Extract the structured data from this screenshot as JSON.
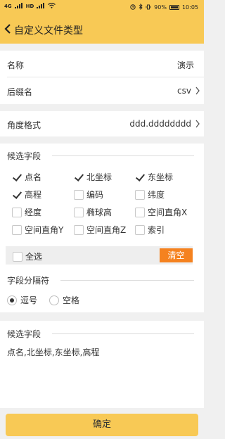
{
  "status_bar": {
    "signal_left": "4G",
    "signal_left2": "HD",
    "battery_pct": "90%",
    "time": "10:05"
  },
  "header": {
    "title": "自定义文件类型",
    "back_icon": "chevron-left-icon"
  },
  "form": {
    "name_label": "名称",
    "name_value": "演示",
    "suffix_label": "后缀名",
    "suffix_value": "csv",
    "angle_label": "角度格式",
    "angle_value": "ddd.dddddddd"
  },
  "candidates": {
    "title": "候选字段",
    "items": [
      {
        "label": "点名",
        "checked": true
      },
      {
        "label": "北坐标",
        "checked": true
      },
      {
        "label": "东坐标",
        "checked": true
      },
      {
        "label": "高程",
        "checked": true
      },
      {
        "label": "编码",
        "checked": false
      },
      {
        "label": "纬度",
        "checked": false
      },
      {
        "label": "经度",
        "checked": false
      },
      {
        "label": "椭球高",
        "checked": false
      },
      {
        "label": "空间直角X",
        "checked": false
      },
      {
        "label": "空间直角Y",
        "checked": false
      },
      {
        "label": "空间直角Z",
        "checked": false
      },
      {
        "label": "索引",
        "checked": false
      }
    ],
    "select_all_label": "全选",
    "clear_label": "清空"
  },
  "separator": {
    "title": "字段分隔符",
    "options": [
      {
        "label": "逗号",
        "selected": true
      },
      {
        "label": "空格",
        "selected": false
      }
    ]
  },
  "selected": {
    "title": "候选字段",
    "value": "点名,北坐标,东坐标,高程"
  },
  "confirm_label": "确定"
}
